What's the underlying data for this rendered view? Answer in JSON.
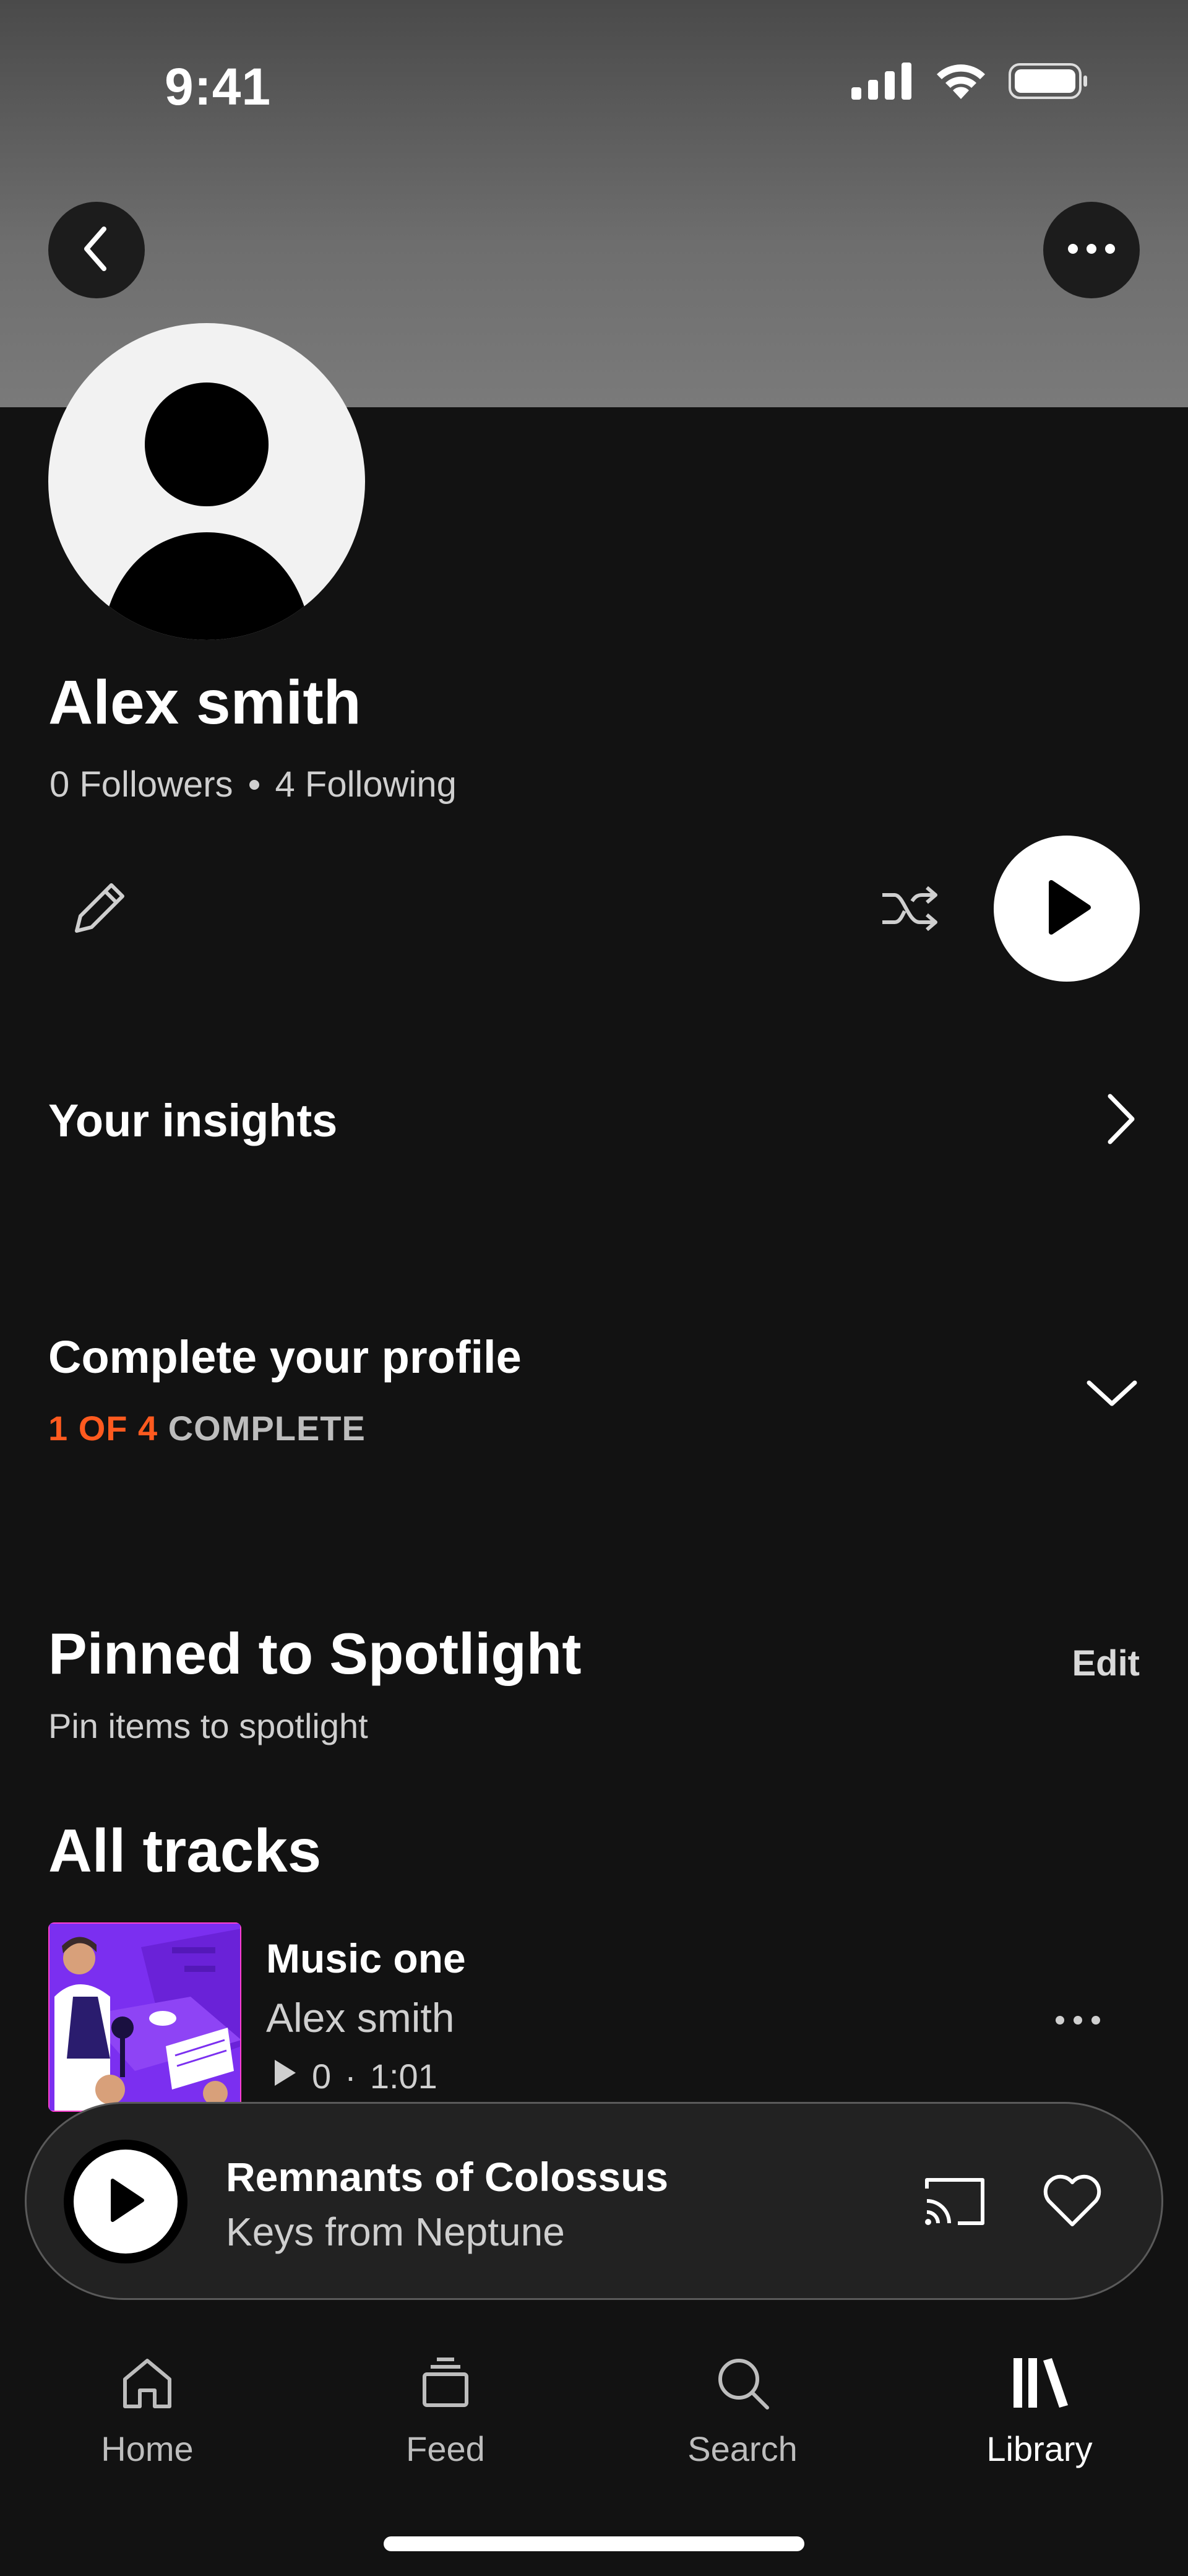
{
  "status_bar": {
    "time": "9:41",
    "icons": [
      "cellular-signal-icon",
      "wifi-icon",
      "battery-icon"
    ]
  },
  "header": {
    "back_icon": "chevron-left-icon",
    "more_icon": "more-horizontal-icon"
  },
  "profile": {
    "name": "Alex smith",
    "followers": "0 Followers",
    "following": "4 Following",
    "avatar_icon": "default-user-avatar"
  },
  "actions": {
    "edit_icon": "pencil-icon",
    "shuffle_icon": "shuffle-icon",
    "play_icon": "play-icon"
  },
  "insights": {
    "label": "Your insights"
  },
  "complete_profile": {
    "label": "Complete your profile",
    "progress_accent": "1 OF 4",
    "progress_rest": "COMPLETE",
    "accent_color": "#ff5a1f"
  },
  "spotlight": {
    "title": "Pinned to Spotlight",
    "subtitle": "Pin items to spotlight",
    "edit_label": "Edit"
  },
  "tracks": {
    "title": "All tracks",
    "items": [
      {
        "title": "Music one",
        "artist": "Alex smith",
        "plays": "0",
        "separator": "·",
        "duration": "1:01"
      }
    ]
  },
  "mini_player": {
    "title": "Remnants of Colossus",
    "artist": "Keys from Neptune"
  },
  "tabbar": {
    "tabs": [
      {
        "label": "Home",
        "icon": "home-icon"
      },
      {
        "label": "Feed",
        "icon": "feed-icon"
      },
      {
        "label": "Search",
        "icon": "search-icon"
      },
      {
        "label": "Library",
        "icon": "library-icon",
        "active": true
      }
    ]
  }
}
